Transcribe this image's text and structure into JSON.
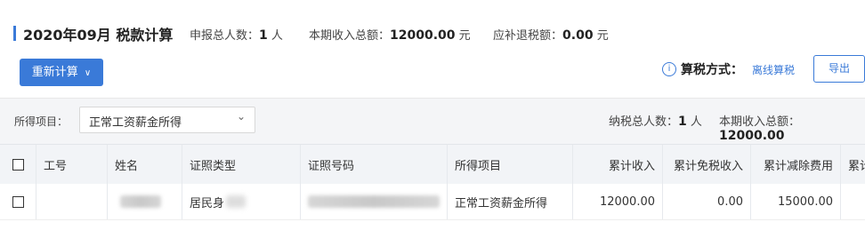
{
  "header": {
    "title": "2020年09月  税款计算",
    "stats": [
      {
        "label": "申报总人数：",
        "value": "1",
        "unit": "人"
      },
      {
        "label": "本期收入总额：",
        "value": "12000.00",
        "unit": "元"
      },
      {
        "label": "应补退税额：",
        "value": "0.00",
        "unit": "元"
      }
    ]
  },
  "toolbar": {
    "recalc_label": "重新计算",
    "method_label": "算税方式：",
    "method_value": "离线算税",
    "export_label": "导出"
  },
  "filter": {
    "label": "所得项目：",
    "selected": "正常工资薪金所得"
  },
  "summary": {
    "count_label": "纳税总人数：",
    "count_value": "1",
    "count_unit": "人",
    "income_label": "本期收入总额：",
    "income_value": "12000.00"
  },
  "table": {
    "columns": [
      "工号",
      "姓名",
      "证照类型",
      "证照号码",
      "所得项目",
      "累计收入",
      "累计免税收入",
      "累计减除费用",
      "累计"
    ],
    "rows": [
      {
        "id_type": "居民身",
        "income_item": "正常工资薪金所得",
        "cum_income": "12000.00",
        "cum_tax_free": "0.00",
        "cum_deduction": "15000.00"
      }
    ]
  }
}
